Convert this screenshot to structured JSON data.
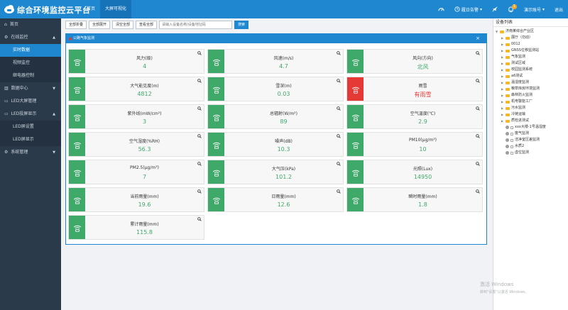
{
  "header": {
    "title": "综合环境监控云平台",
    "nav": [
      "首页",
      "大屏可视化"
    ],
    "right": {
      "speed_icon": "speedometer-icon",
      "history": "履日告警",
      "mute_icon": "mute-icon",
      "notify_badge": "1",
      "account": "演示账号",
      "logout": "退出"
    }
  },
  "sidebar": {
    "items": [
      {
        "label": "首页",
        "icon": "home-icon"
      },
      {
        "label": "在线监控",
        "icon": "gear-icon"
      },
      {
        "label": "实时数据"
      },
      {
        "label": "视频监控"
      },
      {
        "label": "继电器控制"
      },
      {
        "label": "数据中心",
        "icon": "chart-icon"
      },
      {
        "label": "LED大屏管理",
        "icon": "monitor-icon"
      },
      {
        "label": "LED投屏显示",
        "icon": "monitor-icon"
      },
      {
        "label": "LED屏设置"
      },
      {
        "label": "LED屏显示"
      },
      {
        "label": "系统管理",
        "icon": "settings-icon"
      }
    ]
  },
  "toolbar": {
    "collapse_all": "全部折叠",
    "expand_all": "全部展开",
    "clear_all": "清空全部",
    "view_all": "查看全部",
    "search_placeholder": "请输入设备名称/设备地址码",
    "search_button": "搜索"
  },
  "panel": {
    "title": "公路气象监测",
    "close": "×"
  },
  "cards": [
    {
      "name": "风力(级)",
      "value": "4"
    },
    {
      "name": "风速(m/s)",
      "value": "4.7"
    },
    {
      "name": "风向(方向)",
      "value": "北风"
    },
    {
      "name": "大气能见度(m)",
      "value": "4812"
    },
    {
      "name": "雪深(m)",
      "value": "0.03"
    },
    {
      "name": "雨雪",
      "value": "有雨雪",
      "alarm": true
    },
    {
      "name": "紫外线(mW/cm²)",
      "value": "3"
    },
    {
      "name": "总辐射(W/m²)",
      "value": "89"
    },
    {
      "name": "空气温度(℃)",
      "value": "2.9"
    },
    {
      "name": "空气湿度(%RH)",
      "value": "56.3"
    },
    {
      "name": "噪声(dB)",
      "value": "10.3"
    },
    {
      "name": "PM10(μg/m³)",
      "value": "10"
    },
    {
      "name": "PM2.5(μg/m³)",
      "value": "7"
    },
    {
      "name": "大气压(kPa)",
      "value": "101.2"
    },
    {
      "name": "光照(Lux)",
      "value": "14950"
    },
    {
      "name": "当前雨量(mm)",
      "value": "19.6"
    },
    {
      "name": "日雨量(mm)",
      "value": "12.6"
    },
    {
      "name": "瞬时雨量(mm)",
      "value": "1.8"
    },
    {
      "name": "累计雨量(mm)",
      "value": "115.8"
    }
  ],
  "device_tree": {
    "title": "设备列表",
    "root": "济南某综合产业区",
    "folders": [
      "展厅（勿动）",
      "0012",
      "GNSS位移监测站",
      "气象监测",
      "测试区域",
      "校园监测系统",
      "a6测试",
      "温湿度监测",
      "粮草库房环境监测",
      "森林防火监测",
      "机电警能工厂",
      "污水监测",
      "冷链运输",
      "质检进测试"
    ],
    "devices": [
      "xxx大楼-1号温湿度",
      "废气监测",
      "洁净室压差监测",
      "水质2",
      "虚位监测"
    ]
  },
  "watermark": {
    "line1": "激活 Windows",
    "line2": "转到\"设置\"以激活 Windows。"
  }
}
